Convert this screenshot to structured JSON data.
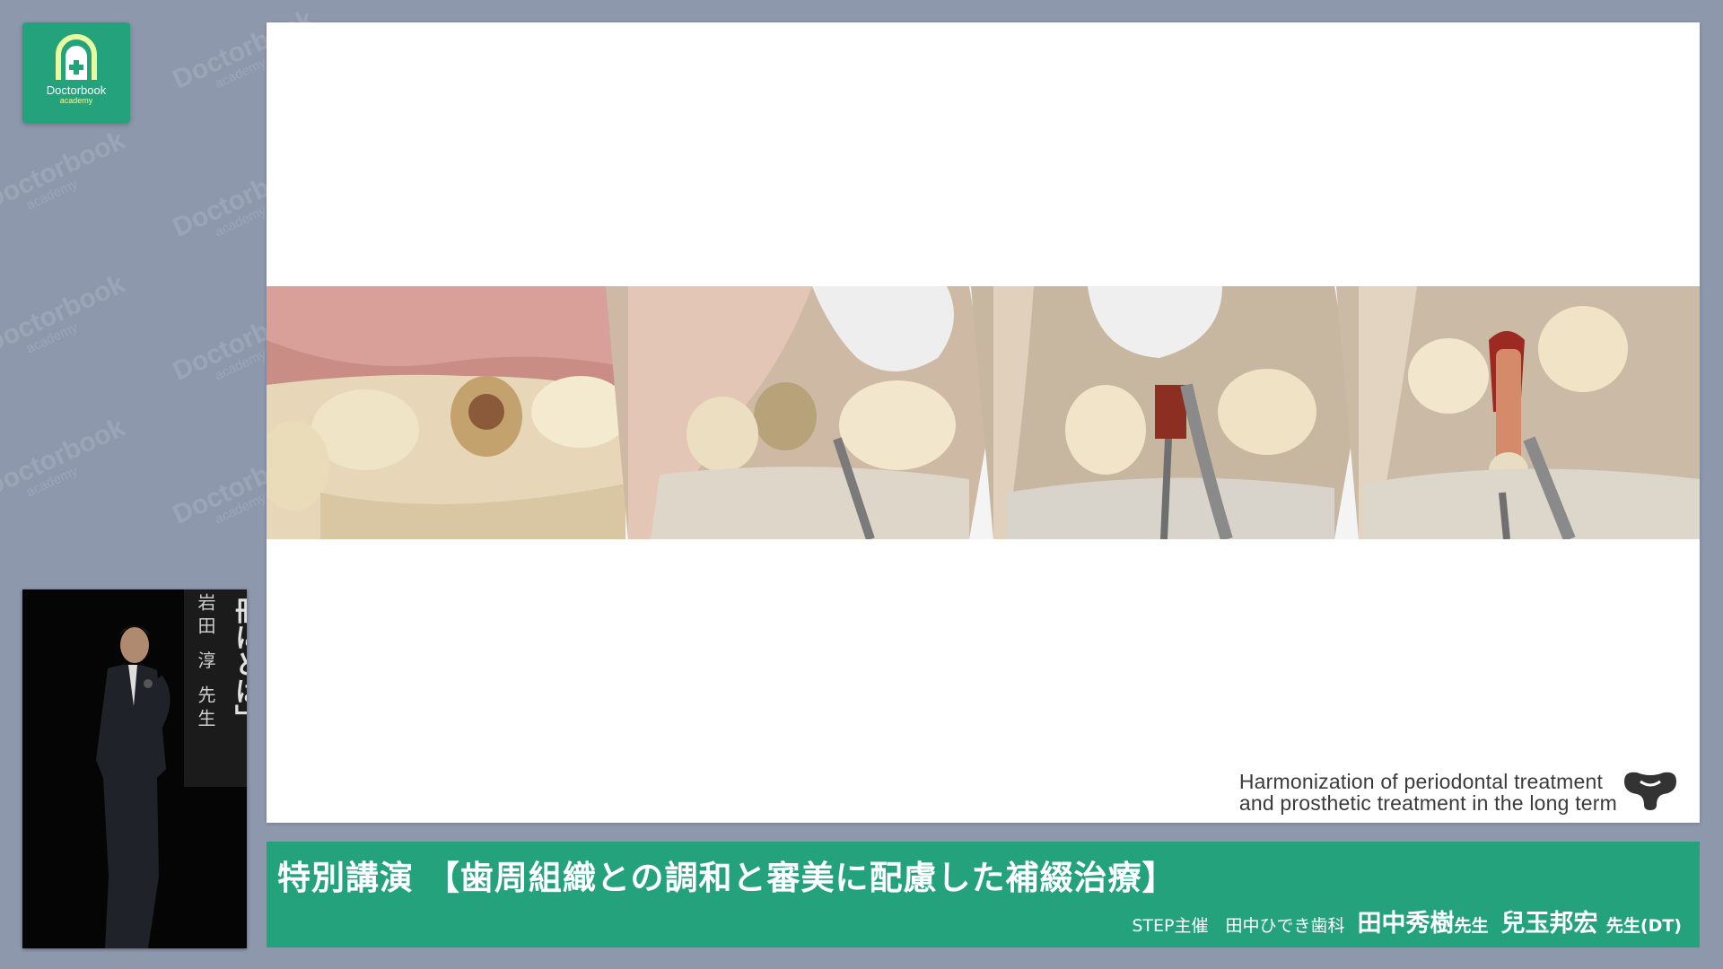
{
  "watermark": {
    "brand": "Doctorbook",
    "sub": "academy"
  },
  "logo": {
    "brand": "Doctorbook",
    "sub": "academy",
    "accent": "#24a27c"
  },
  "slide": {
    "caption_line1": "Harmonization of periodontal treatment",
    "caption_line2": "and prosthetic treatment in the long term"
  },
  "video": {
    "banner_name": "岩田 淳 先生",
    "banner_title": "冊にとは」"
  },
  "bar": {
    "title": "特別講演 【歯周組織との調和と審美に配慮した補綴治療】",
    "organizer": "STEP主催　田中ひでき歯科",
    "speaker1": "田中秀樹",
    "speaker1_suffix": "先生",
    "speaker2": "兒玉邦宏",
    "speaker2_suffix": "先生(DT)",
    "color": "#24a27c"
  }
}
